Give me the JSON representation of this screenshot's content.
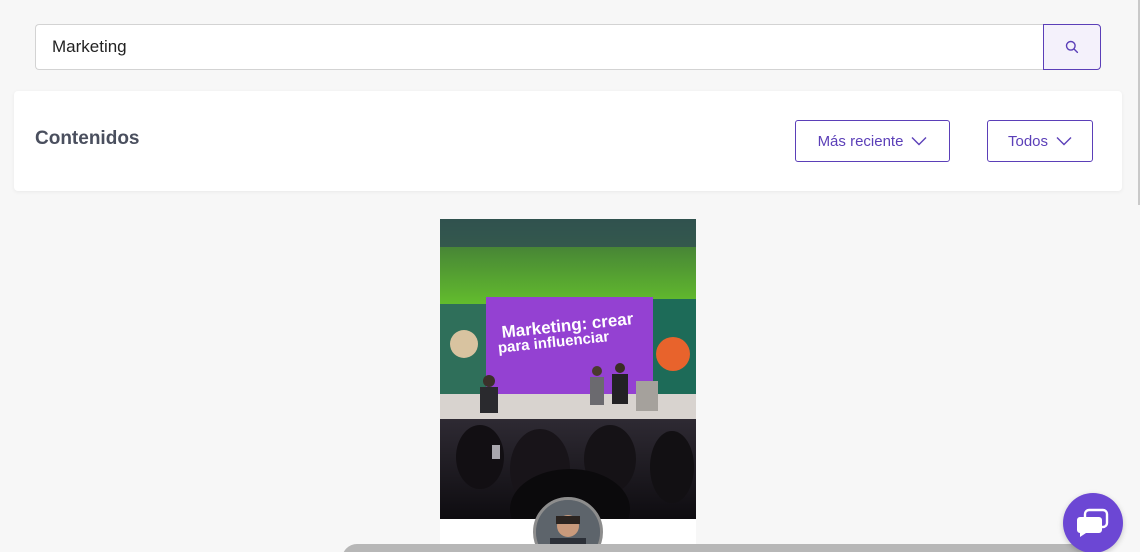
{
  "search": {
    "value": "Marketing",
    "icon": "search-icon"
  },
  "filters": {
    "title": "Contenidos",
    "sort_label": "Más reciente",
    "type_label": "Todos",
    "dropdown_icon": "chevron-down-icon"
  },
  "card": {
    "image_text_line1": "Marketing: crear",
    "image_text_line2": "para influenciar"
  },
  "chat": {
    "icon": "chat-bubble-icon"
  },
  "colors": {
    "accent": "#5b3fb8",
    "chat": "#6c47d4",
    "title": "#4a4f5e",
    "background": "#f7f7f7"
  }
}
